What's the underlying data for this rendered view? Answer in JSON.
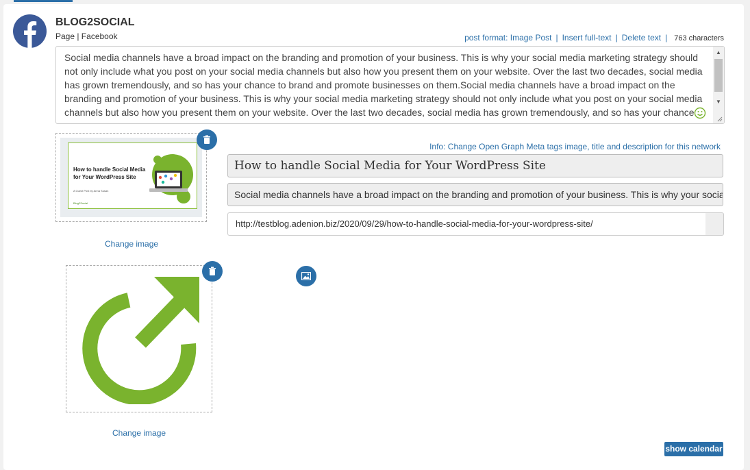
{
  "network": {
    "name": "BLOG2SOCIAL",
    "subtitle": "Page | Facebook",
    "icon": "facebook-icon",
    "brand_color": "#3b5998"
  },
  "actions": {
    "post_format": "post format: Image Post",
    "insert_full_text": "Insert full-text",
    "delete_text": "Delete text",
    "separator": "|",
    "char_count": "763 characters"
  },
  "post_text": "Social media channels have a broad impact on the branding and promotion of your business. This is why your social media marketing strategy should not only include what you post on your social media channels but also how you present them on your website. Over the last two decades, social media has grown tremendously, and so has your chance to brand and promote businesses on them.Social media channels have a broad impact on the branding and promotion of your business. This is why your social media marketing strategy should not only include what you post on your social media channels but also how you present them on your website. Over the last two decades, social media has grown tremendously, and so has your chance to brand and promote businesses on them.",
  "og": {
    "info_link": "Info: Change Open Graph Meta tags image, title and description for this network",
    "title": "How to handle Social Media for Your WordPress Site",
    "description": "Social media channels have a broad impact on the branding and promotion of your business. This is why your social media marketing strategy should not only include what you post",
    "url": "http://testblog.adenion.biz/2020/09/29/how-to-handle-social-media-for-your-wordpress-site/"
  },
  "thumbnail": {
    "title": "How to handle Social Media for Your WordPress Site",
    "byline": "A Guest Post by Anna Susan",
    "logo_text": "Blog2Social"
  },
  "images": {
    "change_label_1": "Change image",
    "change_label_2": "Change image"
  },
  "buttons": {
    "show_calendar": "show calendar"
  },
  "colors": {
    "accent": "#2b6fa8",
    "share_green": "#7ab32e"
  }
}
